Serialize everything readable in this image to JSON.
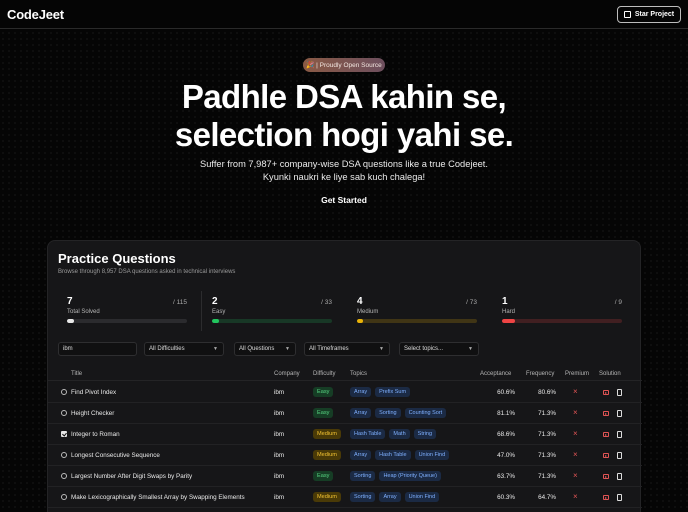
{
  "header": {
    "logo": "CodeJeet",
    "star_label": "Star Project"
  },
  "hero": {
    "badge": "🎉 | Proudly Open Source",
    "title_line1": "Padhle DSA kahin se,",
    "title_line2": "selection hogi yahi se.",
    "subtitle_line1": "Suffer from 7,987+ company-wise DSA questions like a true Codejeet.",
    "subtitle_line2": "Kyunki naukri ke liye sab kuch chalega!",
    "cta": "Get Started"
  },
  "practice": {
    "title": "Practice Questions",
    "subtitle": "Browse through 8,957 DSA questions asked in technical interviews",
    "stats": [
      {
        "value": "7",
        "label": "Total Solved",
        "total": "/ 115",
        "progress": 0.06,
        "color": "#e8e8e8"
      },
      {
        "value": "2",
        "label": "Easy",
        "total": "/ 33",
        "progress": 0.06,
        "color": "#22c55e"
      },
      {
        "value": "4",
        "label": "Medium",
        "total": "/ 73",
        "progress": 0.05,
        "color": "#eab308"
      },
      {
        "value": "1",
        "label": "Hard",
        "total": "/ 9",
        "progress": 0.11,
        "color": "#ef4444"
      }
    ],
    "filters": {
      "search_value": "ibm",
      "difficulty": "All Difficulties",
      "questions": "All Questions",
      "timeframe": "All Timeframes",
      "topics": "Select topics..."
    },
    "columns": {
      "title": "Title",
      "company": "Company",
      "difficulty": "Difficulty",
      "topics": "Topics",
      "acceptance": "Acceptance",
      "frequency": "Frequency",
      "premium": "Premium",
      "solution": "Solution"
    },
    "rows": [
      {
        "solved": false,
        "title": "Find Pivot Index",
        "company": "ibm",
        "difficulty": "Easy",
        "topics": [
          "Array",
          "Prefix Sum"
        ],
        "acceptance": "60.6%",
        "frequency": "80.6%"
      },
      {
        "solved": false,
        "title": "Height Checker",
        "company": "ibm",
        "difficulty": "Easy",
        "topics": [
          "Array",
          "Sorting",
          "Counting Sort"
        ],
        "acceptance": "81.1%",
        "frequency": "71.3%"
      },
      {
        "solved": true,
        "title": "Integer to Roman",
        "company": "ibm",
        "difficulty": "Medium",
        "topics": [
          "Hash Table",
          "Math",
          "String"
        ],
        "acceptance": "68.6%",
        "frequency": "71.3%"
      },
      {
        "solved": false,
        "title": "Longest Consecutive Sequence",
        "company": "ibm",
        "difficulty": "Medium",
        "topics": [
          "Array",
          "Hash Table",
          "Union Find"
        ],
        "acceptance": "47.0%",
        "frequency": "71.3%"
      },
      {
        "solved": false,
        "title": "Largest Number After Digit Swaps by Parity",
        "company": "ibm",
        "difficulty": "Easy",
        "topics": [
          "Sorting",
          "Heap (Priority Queue)"
        ],
        "acceptance": "63.7%",
        "frequency": "71.3%"
      },
      {
        "solved": false,
        "title": "Make Lexicographically Smallest Array by Swapping Elements",
        "company": "ibm",
        "difficulty": "Medium",
        "topics": [
          "Sorting",
          "Array",
          "Union Find"
        ],
        "acceptance": "60.3%",
        "frequency": "64.7%"
      }
    ],
    "premium_mark": "×"
  }
}
